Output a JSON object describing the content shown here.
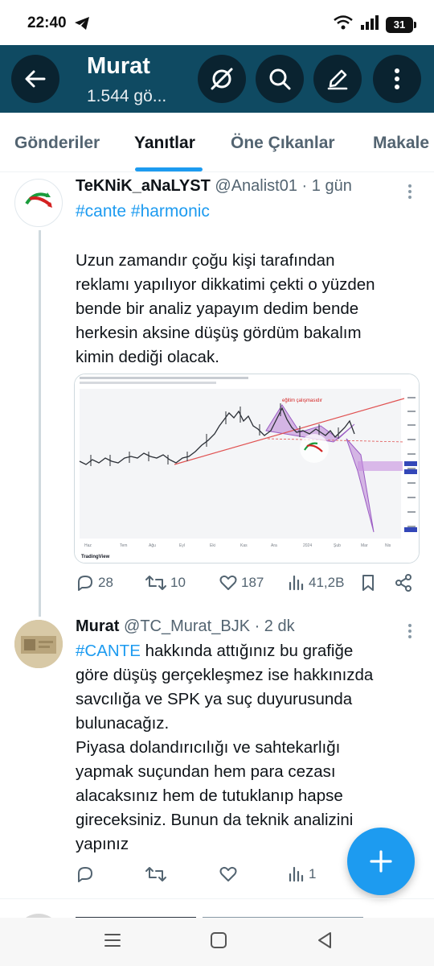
{
  "status_bar": {
    "time": "22:40",
    "battery": "31"
  },
  "header": {
    "name": "Murat",
    "subtitle": "1.544 gö..."
  },
  "tabs": [
    {
      "label": "Gönderiler"
    },
    {
      "label": "Yanıtlar"
    },
    {
      "label": "Öne Çıkanlar"
    },
    {
      "label": "Makale"
    }
  ],
  "tweet1": {
    "name": "TeKNiK_aNaLYST",
    "handle": "@Analist01",
    "time": "· 1 gün",
    "hashtags": "#cante #harmonic",
    "text": "Uzun zamandır çoğu kişi tarafından\nreklamı yapılıyor dikkatimi çekti o yüzden\nbende bir analiz yapayım dedim bende\nherkesin aksine düşüş gördüm bakalım\nkimin dediği olacak.",
    "replies": "28",
    "retweets": "10",
    "likes": "187",
    "views": "41,2B",
    "chart_caption": "eğitim çalışmasıdır",
    "chart_watermark": "TradingView",
    "avatar_text": "@TeKNiK_aNaLYST",
    "chart_axis_labels": [
      "Haz",
      "Tem",
      "Ağu",
      "Eyl",
      "Eki",
      "Kas",
      "Ara",
      "2024",
      "Şub",
      "Mar",
      "Nis"
    ]
  },
  "tweet2": {
    "name": "Murat",
    "handle": "@TC_Murat_BJK",
    "time": "· 2 dk",
    "tag": "#CANTE",
    "text_after_tag": " hakkında attığınız bu grafiğe",
    "text": "göre düşüş gerçekleşmez ise hakkınızda\nsavcılığa ve SPK ya suç duyurusunda\nbulunacağız.\nPiyasa dolandırıcılığı ve sahtekarlığı\nyapmak suçundan hem para cezası\nalacaksınız hem de tutuklanıp hapse\ngireceksiniz. Bunun da teknik analizini\nyapınız",
    "views": "1"
  }
}
